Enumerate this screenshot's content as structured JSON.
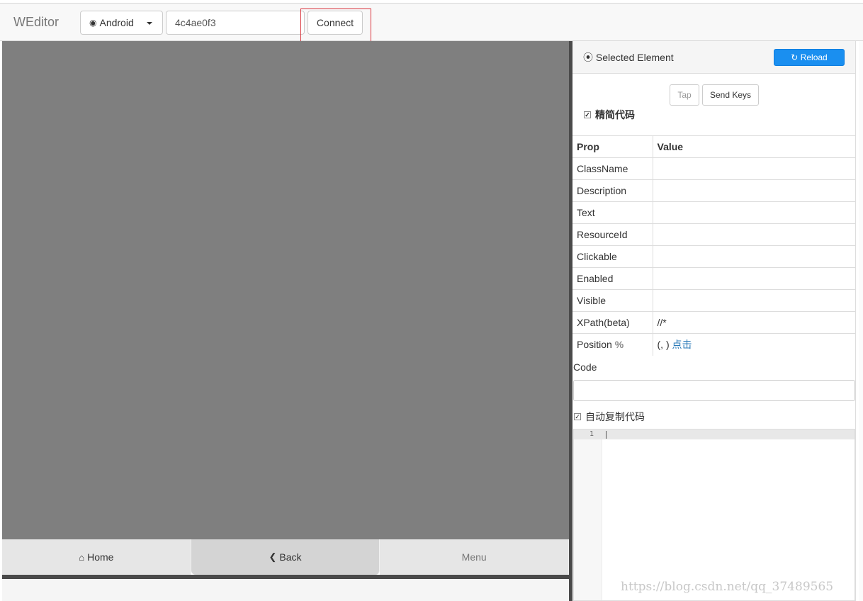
{
  "topbar": {
    "brand": "WEditor",
    "platform_label": "Android",
    "serial_value": "4c4ae0f3",
    "connect_label": "Connect"
  },
  "navbar": {
    "home_label": "Home",
    "back_label": "Back",
    "menu_label": "Menu"
  },
  "panel": {
    "title": "Selected Element",
    "reload_label": "Reload",
    "tap_label": "Tap",
    "send_keys_label": "Send Keys",
    "simple_code_label": "精简代码",
    "simple_code_checked": true,
    "props_header": {
      "prop": "Prop",
      "value": "Value"
    },
    "props": [
      {
        "key": "ClassName",
        "value": ""
      },
      {
        "key": "Description",
        "value": ""
      },
      {
        "key": "Text",
        "value": ""
      },
      {
        "key": "ResourceId",
        "value": ""
      },
      {
        "key": "Clickable",
        "value": ""
      },
      {
        "key": "Enabled",
        "value": ""
      },
      {
        "key": "Visible",
        "value": ""
      },
      {
        "key": "XPath(beta)",
        "value": "//*"
      }
    ],
    "position": {
      "key": "Position",
      "pct_symbol": "%",
      "value": "(, )",
      "link": "点击"
    },
    "code_label": "Code",
    "code_value": "",
    "auto_copy_label": "自动复制代码",
    "auto_copy_checked": true,
    "editor_line_number": "1"
  },
  "watermark": "https://blog.csdn.net/qq_37489565",
  "icons": {
    "platform": "android-icon",
    "selected": "target-icon",
    "reload": "refresh-icon",
    "home": "home-icon",
    "back": "chevron-left-icon"
  },
  "colors": {
    "accent": "#1a8ff0",
    "screen": "#7f7f7f",
    "highlight": "#d9323a",
    "link": "#2a7ab8"
  }
}
